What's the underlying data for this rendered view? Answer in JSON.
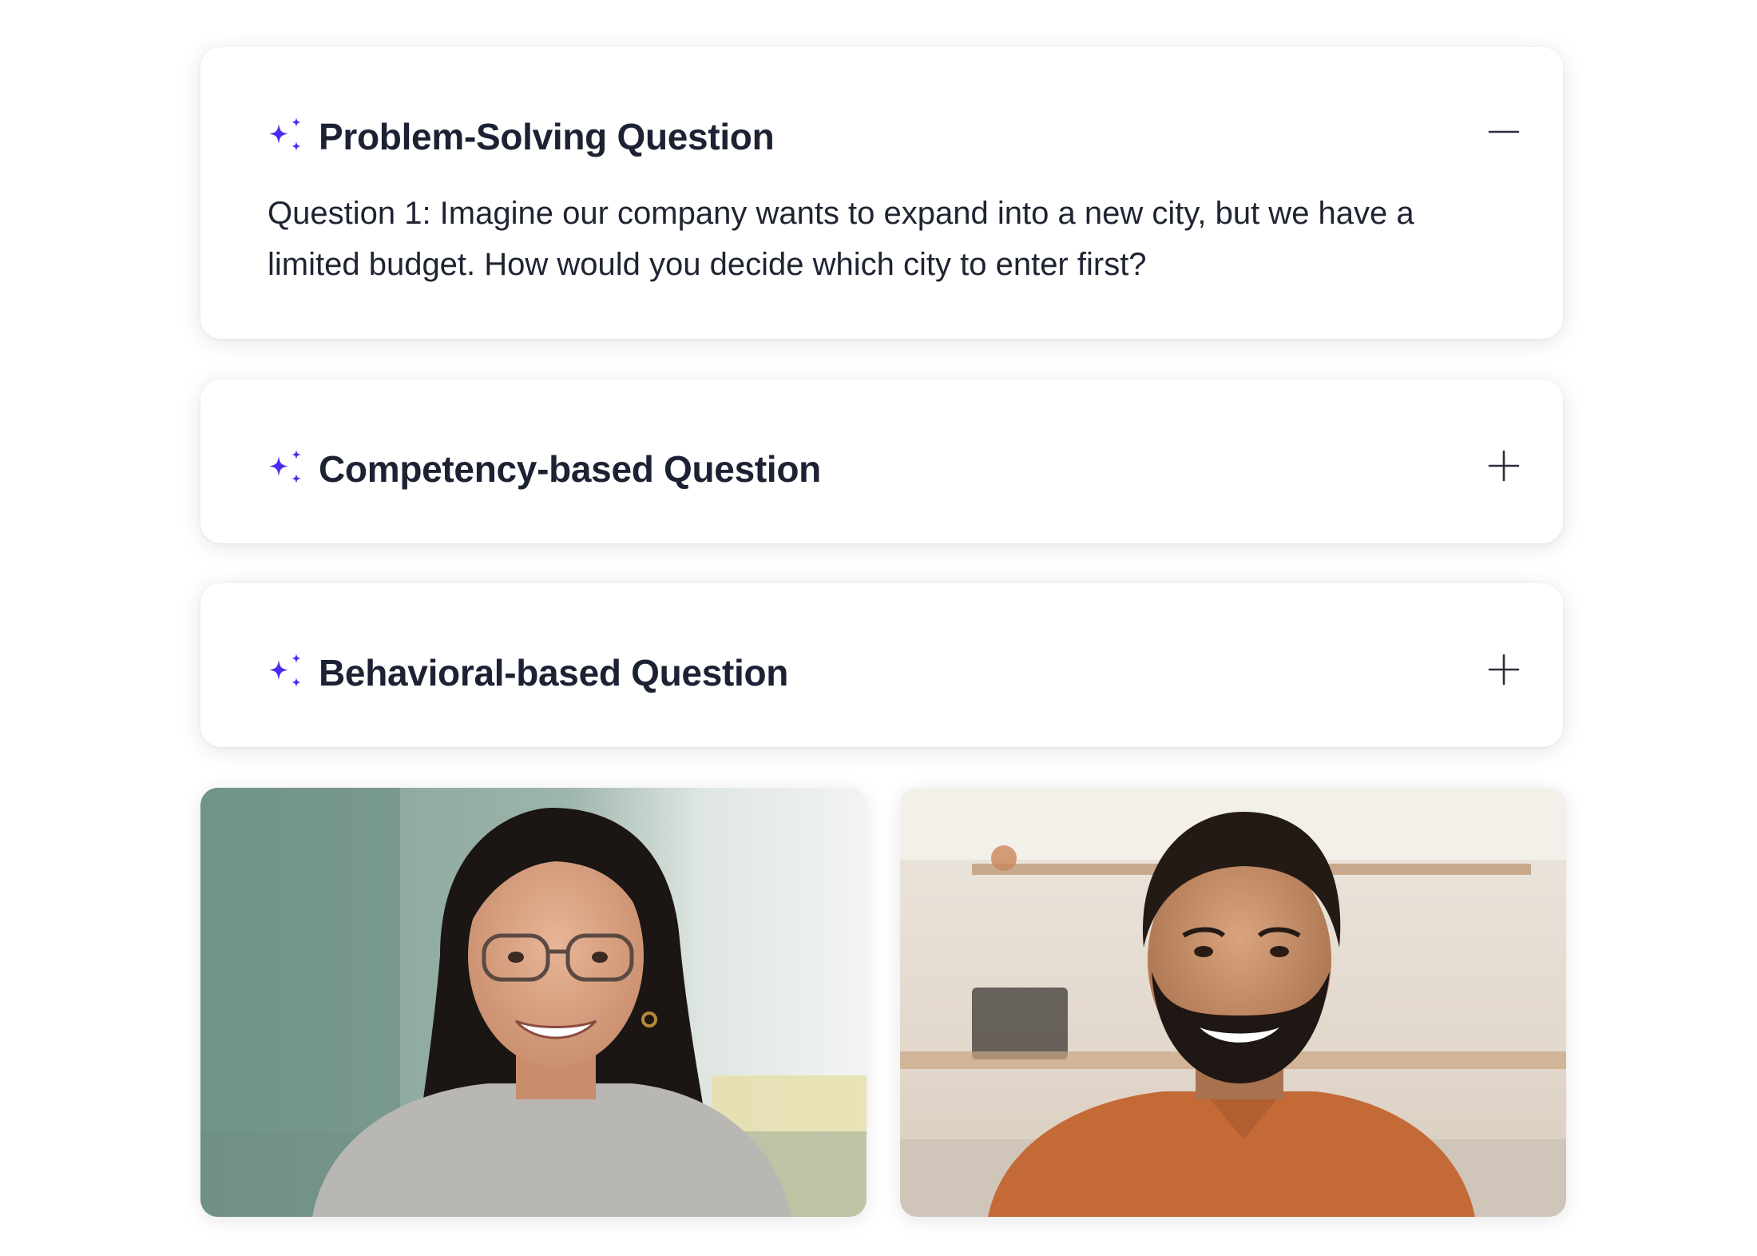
{
  "accordion": {
    "items": [
      {
        "title": "Problem-Solving Question",
        "expanded": true,
        "toggle_icon": "minus-icon",
        "body": "Question 1: Imagine our company wants to expand into a new city, but we have a limited budget. How would you decide which city to enter first?"
      },
      {
        "title": "Competency-based Question",
        "expanded": false,
        "toggle_icon": "plus-icon"
      },
      {
        "title": "Behavioral-based Question",
        "expanded": false,
        "toggle_icon": "plus-icon"
      }
    ],
    "sparkle_icon": "sparkles-icon",
    "accent_color": "#4a2cf0",
    "title_color": "#1c2233"
  },
  "participants": [
    {
      "description": "woman with glasses smiling"
    },
    {
      "description": "bearded man in orange shirt smiling"
    }
  ]
}
